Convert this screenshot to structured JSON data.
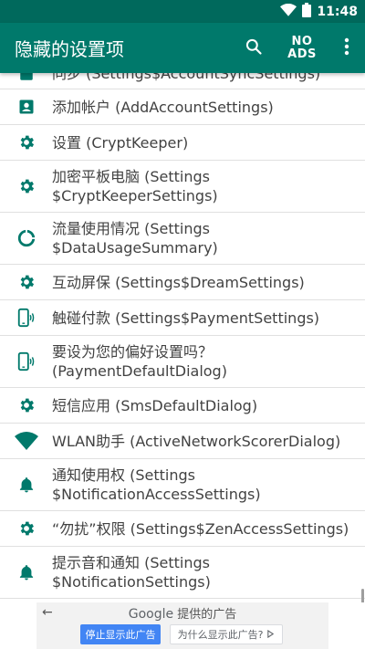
{
  "status": {
    "time": "11:48"
  },
  "appbar": {
    "title": "隐藏的设置项",
    "noads_line1": "NO",
    "noads_line2": "ADS",
    "search_icon": "search-icon",
    "more_icon": "more-vert-icon"
  },
  "colors": {
    "primary": "#00796b",
    "primary_dark": "#00695c",
    "icon": "#00796b"
  },
  "items": [
    {
      "label": "同步 (Settings$AccountSyncSettings)",
      "icon": "sync-icon"
    },
    {
      "label": "添加帐户 (AddAccountSettings)",
      "icon": "account-box-icon"
    },
    {
      "label": "设置 (CryptKeeper)",
      "icon": "gear-icon"
    },
    {
      "label": "加密平板电脑 (Settings $CryptKeeperSettings)",
      "icon": "gear-icon"
    },
    {
      "label": "流量使用情况 (Settings $DataUsageSummary)",
      "icon": "data-usage-icon"
    },
    {
      "label": "互动屏保 (Settings$DreamSettings)",
      "icon": "gear-icon"
    },
    {
      "label": "触碰付款 (Settings$PaymentSettings)",
      "icon": "nfc-phone-icon"
    },
    {
      "label": "要设为您的偏好设置吗？(PaymentDefaultDialog)",
      "icon": "nfc-phone-icon"
    },
    {
      "label": "短信应用 (SmsDefaultDialog)",
      "icon": "gear-icon"
    },
    {
      "label": "WLAN助手 (ActiveNetworkScorerDialog)",
      "icon": "wifi-icon"
    },
    {
      "label": "通知使用权 (Settings $NotificationAccessSettings)",
      "icon": "bell-icon"
    },
    {
      "label": "“勿扰”权限 (Settings$ZenAccessSettings)",
      "icon": "gear-icon"
    },
    {
      "label": "提示音和通知 (Settings $NotificationSettings)",
      "icon": "bell-icon"
    }
  ],
  "ad": {
    "brand": "Google",
    "provided": "提供的广告",
    "stop_label": "停止显示此广告",
    "why_label": "为什么显示此广告?"
  }
}
